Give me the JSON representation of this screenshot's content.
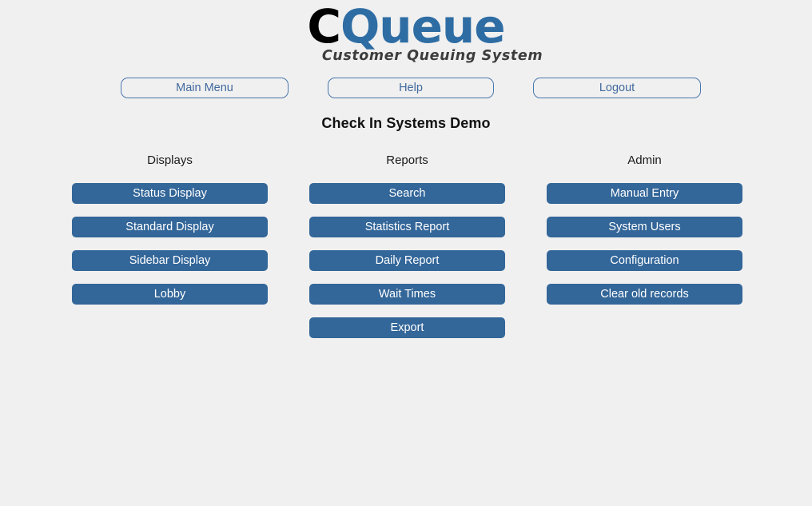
{
  "brand": {
    "logo_primary": "C",
    "logo_secondary": "Queue",
    "logo_full": "CQueue",
    "tagline": "Customer Queuing System",
    "color_primary": "#2e6da4",
    "color_black": "#000000",
    "color_tagline": "#3d3d3d"
  },
  "top_nav": {
    "items": [
      {
        "label": "Main Menu",
        "name": "main-menu"
      },
      {
        "label": "Help",
        "name": "help"
      },
      {
        "label": "Logout",
        "name": "logout"
      }
    ]
  },
  "page": {
    "title": "Check In Systems Demo",
    "background_color": "#f0f0f0",
    "button_color": "#336699",
    "button_text_color": "#ffffff",
    "nav_border_color": "#4a77ad",
    "nav_text_color": "#41699e"
  },
  "columns": [
    {
      "heading": "Displays",
      "buttons": [
        {
          "label": "Status Display"
        },
        {
          "label": "Standard Display"
        },
        {
          "label": "Sidebar Display"
        },
        {
          "label": "Lobby"
        }
      ]
    },
    {
      "heading": "Reports",
      "buttons": [
        {
          "label": "Search"
        },
        {
          "label": "Statistics Report"
        },
        {
          "label": "Daily Report"
        },
        {
          "label": "Wait Times"
        },
        {
          "label": "Export"
        }
      ]
    },
    {
      "heading": "Admin",
      "buttons": [
        {
          "label": "Manual Entry"
        },
        {
          "label": "System Users"
        },
        {
          "label": "Configuration"
        },
        {
          "label": "Clear old records"
        }
      ]
    }
  ]
}
